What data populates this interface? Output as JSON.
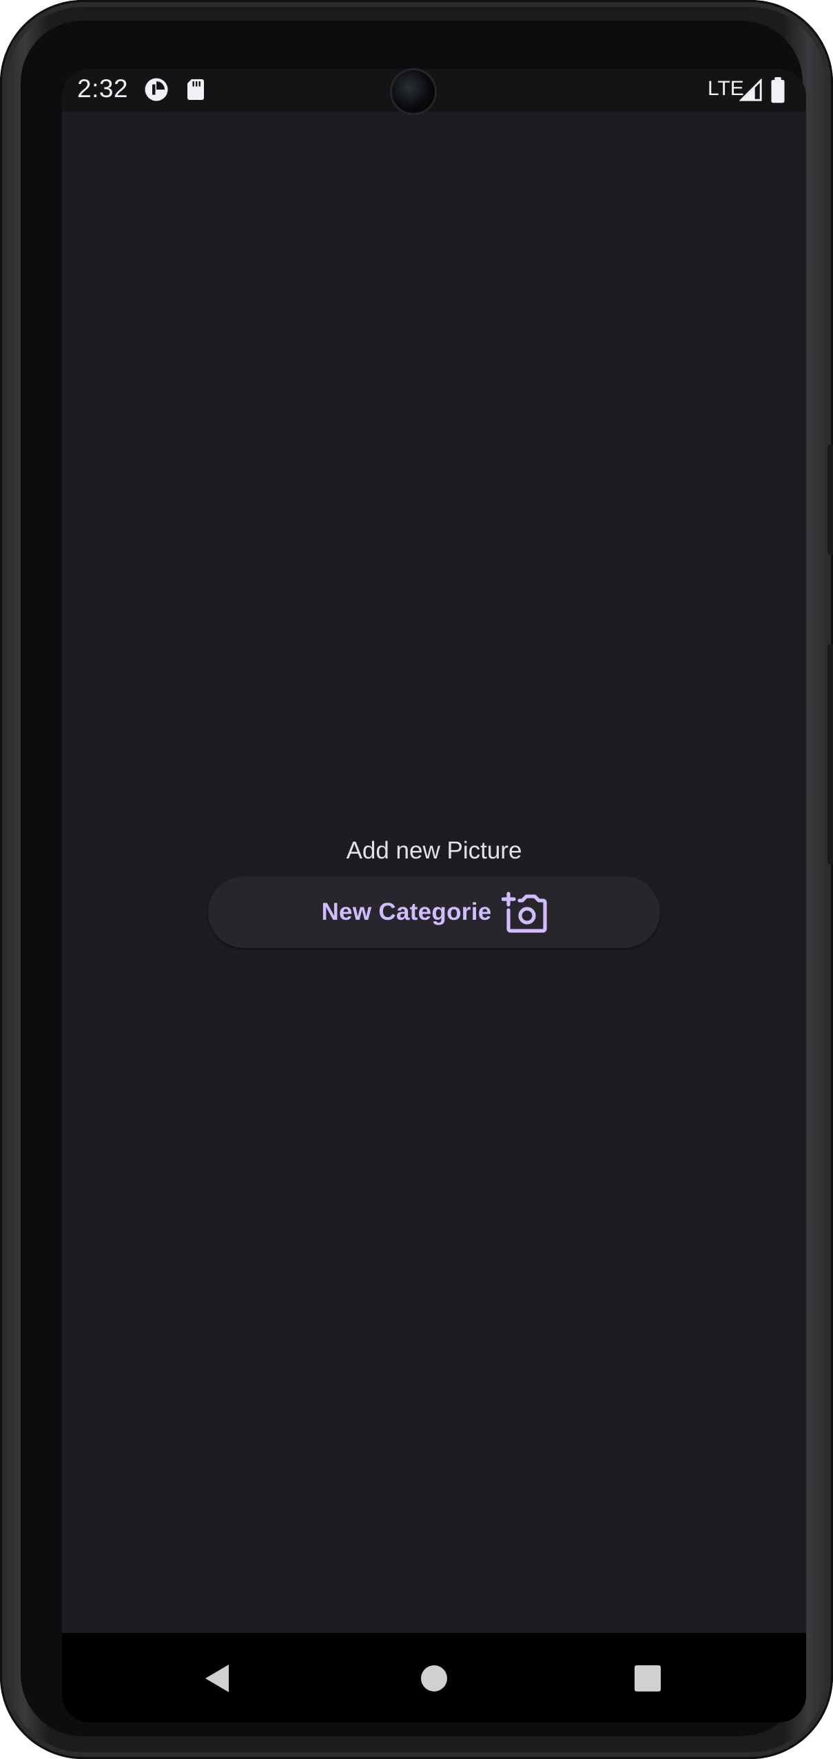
{
  "status_bar": {
    "time": "2:32",
    "network": "LTE",
    "icons": [
      "pinwheel-app-icon",
      "sd-card-icon",
      "signal-icon",
      "battery-icon"
    ]
  },
  "main": {
    "title": "Add new Picture",
    "new_category_button": {
      "label": "New Categorie",
      "icon": "add-a-photo-icon"
    }
  },
  "navigation": {
    "buttons": [
      "back-icon",
      "home-icon",
      "recents-icon"
    ]
  },
  "colors": {
    "background": "#1d1c21",
    "button_surface": "#27262c",
    "accent": "#d1bcfd",
    "text": "#e6e1e6"
  }
}
